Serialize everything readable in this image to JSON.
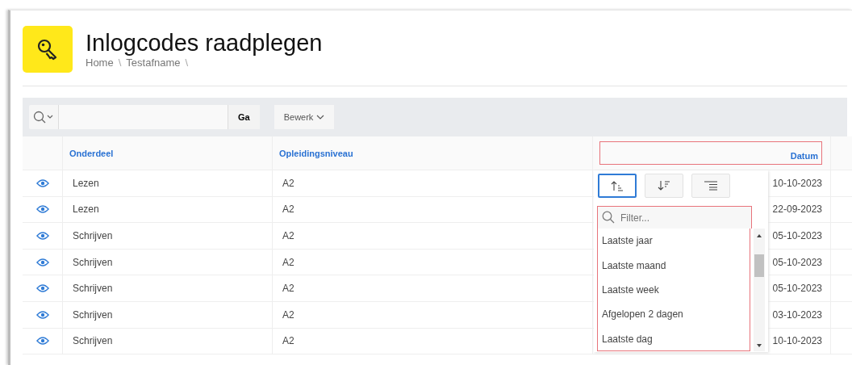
{
  "header": {
    "title": "Inlogcodes raadplegen",
    "breadcrumb": [
      "Home",
      "Testafname"
    ],
    "separator": "\\"
  },
  "toolbar": {
    "go_button": "Ga",
    "edit_button": "Bewerk"
  },
  "table": {
    "columns": [
      {
        "label": "Onderdeel",
        "highlighted": false
      },
      {
        "label": "Opleidingsniveau",
        "highlighted": false
      },
      {
        "label": "Datum",
        "highlighted": true
      }
    ],
    "rows": [
      {
        "onderdeel": "Lezen",
        "niveau": "A2",
        "datum": "10-10-2023"
      },
      {
        "onderdeel": "Lezen",
        "niveau": "A2",
        "datum": "22-09-2023"
      },
      {
        "onderdeel": "Schrijven",
        "niveau": "A2",
        "datum": "05-10-2023"
      },
      {
        "onderdeel": "Schrijven",
        "niveau": "A2",
        "datum": "05-10-2023"
      },
      {
        "onderdeel": "Schrijven",
        "niveau": "A2",
        "datum": "05-10-2023"
      },
      {
        "onderdeel": "Schrijven",
        "niveau": "A2",
        "datum": "03-10-2023"
      },
      {
        "onderdeel": "Schrijven",
        "niveau": "A2",
        "datum": "10-10-2023"
      }
    ]
  },
  "column_menu": {
    "sort_buttons": [
      {
        "kind": "ascending",
        "selected": true
      },
      {
        "kind": "descending",
        "selected": false
      },
      {
        "kind": "align",
        "selected": false
      }
    ],
    "filter": {
      "placeholder": "Filter...",
      "highlighted": true
    },
    "options": [
      "Laatste jaar",
      "Laatste maand",
      "Laatste week",
      "Afgelopen 2 dagen",
      "Laatste dag"
    ]
  }
}
